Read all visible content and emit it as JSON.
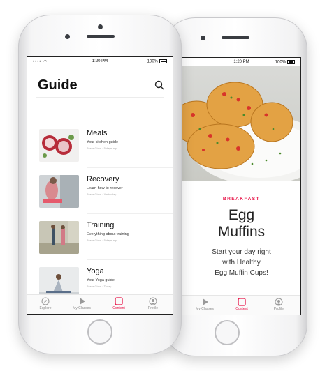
{
  "status_bar": {
    "front": {
      "time": "1:20 PM",
      "battery": "100%"
    },
    "back": {
      "time": "1:20 PM",
      "battery": "100%"
    }
  },
  "guide": {
    "title": "Guide",
    "items": [
      {
        "title": "Meals",
        "subtitle": "Your kitchen guide",
        "meta": "Brace Chen · 5 days ago"
      },
      {
        "title": "Recovery",
        "subtitle": "Learn how to recover",
        "meta": "Brace Chen · Yesterday"
      },
      {
        "title": "Training",
        "subtitle": "Everything about training",
        "meta": "Brace Chen · 5 days ago"
      },
      {
        "title": "Yoga",
        "subtitle": "Your Yoga guide",
        "meta": "Brace Chen · Today"
      }
    ]
  },
  "tabs": {
    "front": [
      {
        "label": "Explore",
        "icon": "compass-icon",
        "active": false
      },
      {
        "label": "My Classes",
        "icon": "play-icon",
        "active": false
      },
      {
        "label": "Content",
        "icon": "content-icon",
        "active": true
      },
      {
        "label": "Profile",
        "icon": "profile-icon",
        "active": false
      }
    ],
    "back": [
      {
        "label": "My Classes",
        "icon": "play-icon",
        "active": false
      },
      {
        "label": "Content",
        "icon": "content-icon",
        "active": true
      },
      {
        "label": "Profile",
        "icon": "profile-icon",
        "active": false
      }
    ]
  },
  "recipe": {
    "category": "BREAKFAST",
    "title_line1": "Egg",
    "title_line2": "Muffins",
    "desc_line1": "Start your day right",
    "desc_line2": "with Healthy",
    "desc_line3": "Egg Muffin Cups!"
  },
  "colors": {
    "accent": "#e8174a",
    "text": "#111111",
    "muted": "#888888"
  }
}
